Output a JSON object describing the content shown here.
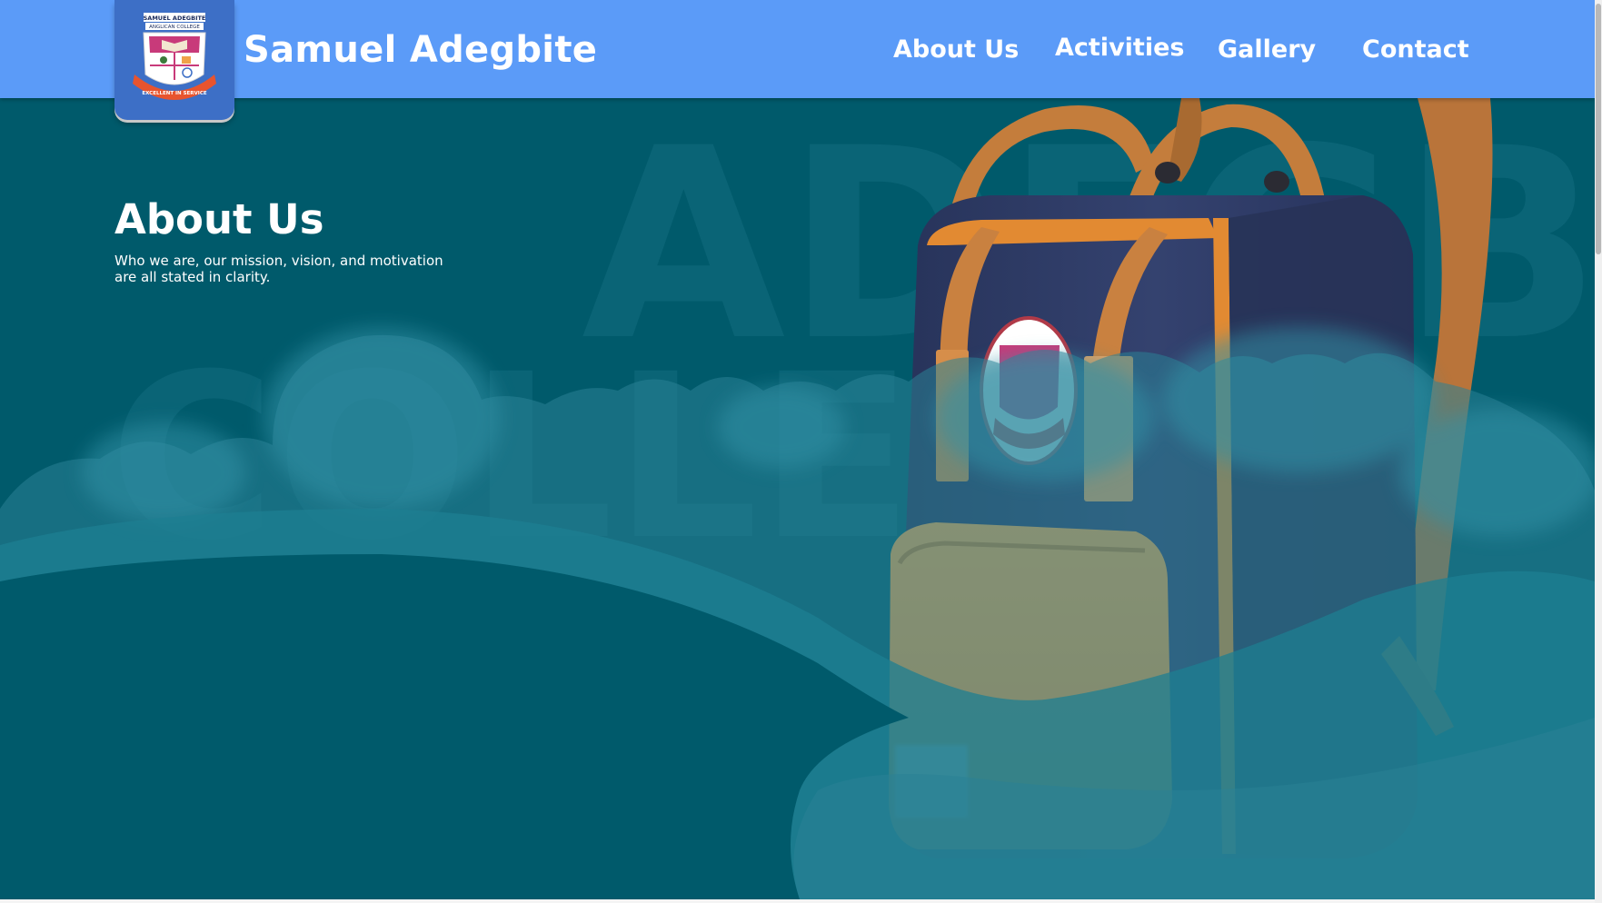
{
  "header": {
    "brand_name": "Samuel Adegbite",
    "logo": {
      "top_text": "SAMUEL ADEGBITE",
      "sub_text": "ANGLICAN COLLEGE",
      "motto": "EXCELLENT IN SERVICE",
      "icon": "school-crest-icon"
    },
    "nav": [
      {
        "label": "About Us"
      },
      {
        "label": "Activities"
      },
      {
        "label": "Gallery"
      },
      {
        "label": "Contact"
      }
    ]
  },
  "hero": {
    "title": "About Us",
    "subtitle": "Who we are, our mission, vision, and motivation are all stated in clarity.",
    "watermark_line1": "ADEGBI",
    "watermark_line2": "COLLE",
    "image": "school-backpack-image"
  },
  "colors": {
    "nav_background": "#5b9bf8",
    "hero_background": "#005a6b",
    "cloud": "#2a8196",
    "badge": "#3d6fc6",
    "backpack_navy": "#2d3a63",
    "backpack_orange": "#f0a24a",
    "strap_brown": "#c07a38"
  }
}
